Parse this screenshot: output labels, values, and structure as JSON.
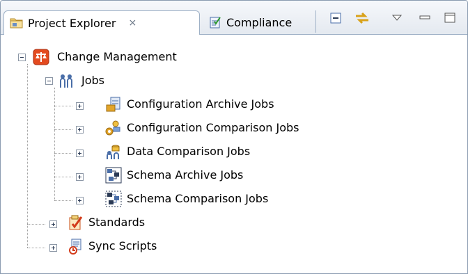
{
  "tabs": [
    {
      "label": "Project Explorer",
      "icon": "folder-project-icon",
      "close": "⨯"
    },
    {
      "label": "Compliance",
      "icon": "compliance-report-icon"
    }
  ],
  "toolbar": [
    "collapse-all-icon",
    "link-with-editor-icon",
    "view-menu-icon",
    "minimize-icon",
    "maximize-icon"
  ],
  "tree": {
    "root": {
      "label": "Change Management",
      "icon": "change-management-icon",
      "state": "expanded"
    },
    "jobs": {
      "label": "Jobs",
      "icon": "jobs-icon",
      "state": "expanded"
    },
    "job_items": [
      {
        "label": "Configuration Archive Jobs",
        "icon": "configuration-archive-icon"
      },
      {
        "label": "Configuration Comparison Jobs",
        "icon": "configuration-comparison-icon"
      },
      {
        "label": "Data Comparison Jobs",
        "icon": "data-comparison-icon"
      },
      {
        "label": "Schema Archive Jobs",
        "icon": "schema-archive-icon"
      },
      {
        "label": "Schema Comparison Jobs",
        "icon": "schema-comparison-icon"
      }
    ],
    "standards": {
      "label": "Standards",
      "icon": "standards-icon",
      "state": "collapsed"
    },
    "sync_scripts": {
      "label": "Sync Scripts",
      "icon": "sync-scripts-icon",
      "state": "collapsed"
    }
  }
}
